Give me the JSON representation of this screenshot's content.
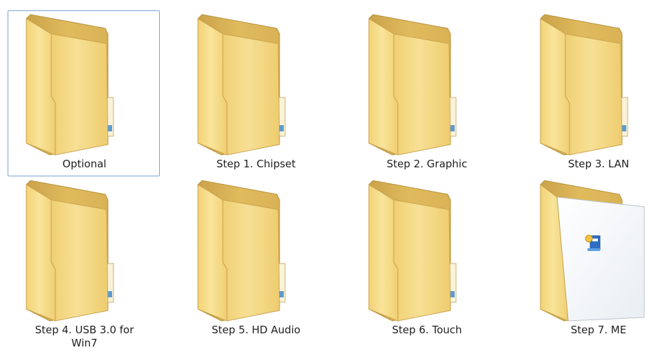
{
  "folders": [
    {
      "name": "Optional",
      "icon": "folder-icon",
      "selected": true
    },
    {
      "name": "Step 1. Chipset",
      "icon": "folder-icon"
    },
    {
      "name": "Step 2. Graphic",
      "icon": "folder-icon"
    },
    {
      "name": "Step 3. LAN",
      "icon": "folder-icon"
    },
    {
      "name": "Step 4. USB 3.0 for",
      "name_line2": "Win7",
      "icon": "folder-icon"
    },
    {
      "name": "Step 5. HD Audio",
      "icon": "folder-icon"
    },
    {
      "name": "Step 6. Touch",
      "icon": "folder-icon"
    },
    {
      "name": "Step 7. ME",
      "icon": "folder-with-document-icon"
    }
  ],
  "colors": {
    "selection_border": "#7da2ce",
    "folder_back": "#e3c063",
    "folder_front": "#f7dc85",
    "label_text": "#1e1e1e"
  }
}
